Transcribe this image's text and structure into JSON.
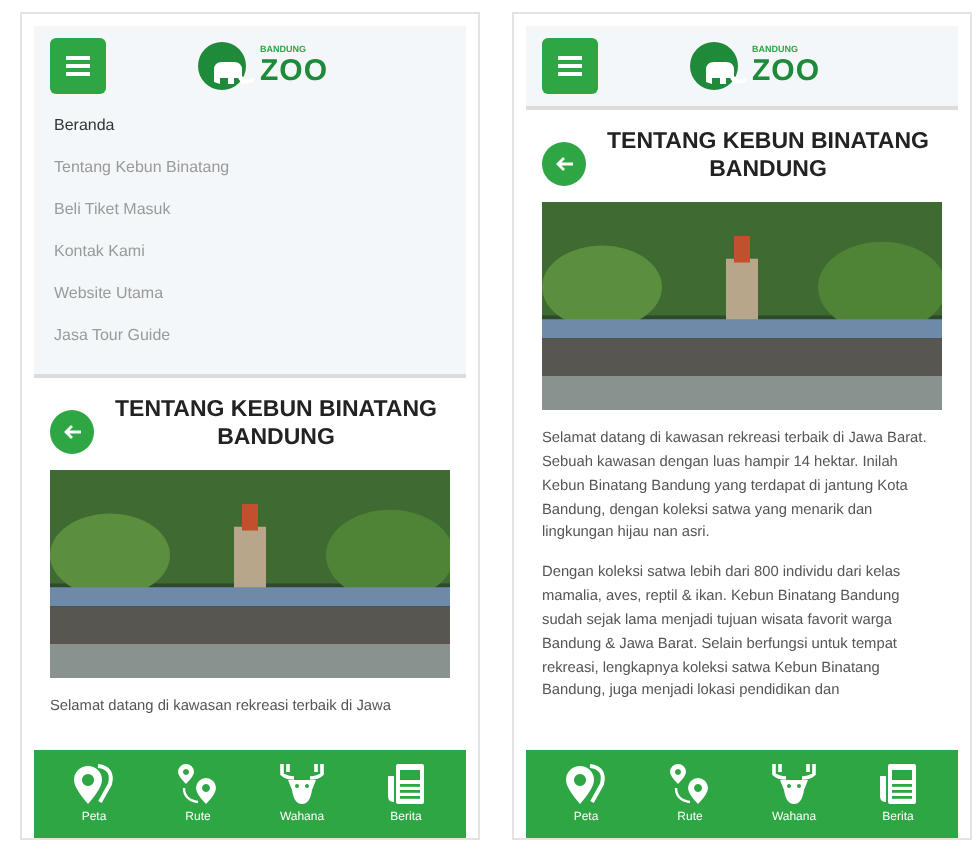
{
  "screens": [
    {
      "logo": {
        "small": "BANDUNG",
        "big": "ZOO"
      },
      "menu_items": [
        {
          "label": "Beranda",
          "selected": true
        },
        {
          "label": "Tentang Kebun Binatang",
          "selected": false
        },
        {
          "label": "Beli Tiket Masuk",
          "selected": false
        },
        {
          "label": "Kontak Kami",
          "selected": false
        },
        {
          "label": "Website Utama",
          "selected": false
        },
        {
          "label": "Jasa Tour Guide",
          "selected": false
        }
      ],
      "title": "TENTANG KEBUN BINATANG BANDUNG",
      "paragraphs": [
        "Selamat datang di kawasan rekreasi terbaik di Jawa"
      ],
      "nav": [
        {
          "kind": "map",
          "label": "Peta"
        },
        {
          "kind": "route",
          "label": "Rute"
        },
        {
          "kind": "deer",
          "label": "Wahana"
        },
        {
          "kind": "news",
          "label": "Berita"
        }
      ]
    },
    {
      "logo": {
        "small": "BANDUNG",
        "big": "ZOO"
      },
      "title": "TENTANG KEBUN BINATANG BANDUNG",
      "paragraphs": [
        "Selamat datang di kawasan rekreasi terbaik di Jawa Barat. Sebuah kawasan dengan luas hampir 14 hektar. Inilah Kebun Binatang Bandung yang terdapat di jantung Kota Bandung, dengan koleksi satwa yang menarik dan lingkungan hijau nan asri.",
        "Dengan koleksi satwa lebih dari 800 individu dari kelas mamalia, aves, reptil & ikan. Kebun Binatang Bandung sudah sejak lama menjadi tujuan wisata favorit warga Bandung & Jawa Barat. Selain berfungsi untuk tempat rekreasi, lengkapnya koleksi satwa Kebun Binatang Bandung, juga menjadi lokasi pendidikan dan"
      ],
      "nav": [
        {
          "kind": "map",
          "label": "Peta"
        },
        {
          "kind": "route",
          "label": "Rute"
        },
        {
          "kind": "deer",
          "label": "Wahana"
        },
        {
          "kind": "news",
          "label": "Berita"
        }
      ]
    }
  ]
}
